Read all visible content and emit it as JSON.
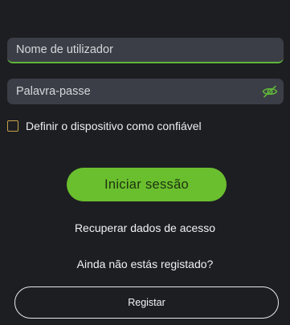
{
  "login": {
    "username": {
      "value": "",
      "placeholder": "Nome de utilizador"
    },
    "password": {
      "value": "",
      "placeholder": "Palavra-passe",
      "toggle_icon": "eye-slash-icon"
    },
    "trusted_device": {
      "label": "Definir o dispositivo como confiável",
      "checked": false
    },
    "submit_label": "Iniciar sessão",
    "recover_label": "Recuperar dados de acesso"
  },
  "register": {
    "prompt": "Ainda não estás registado?",
    "button_label": "Registar"
  },
  "colors": {
    "background": "#1d1e22",
    "field": "#3b3e46",
    "accent": "#6abf2e",
    "checkbox_border": "#c8a24a"
  }
}
